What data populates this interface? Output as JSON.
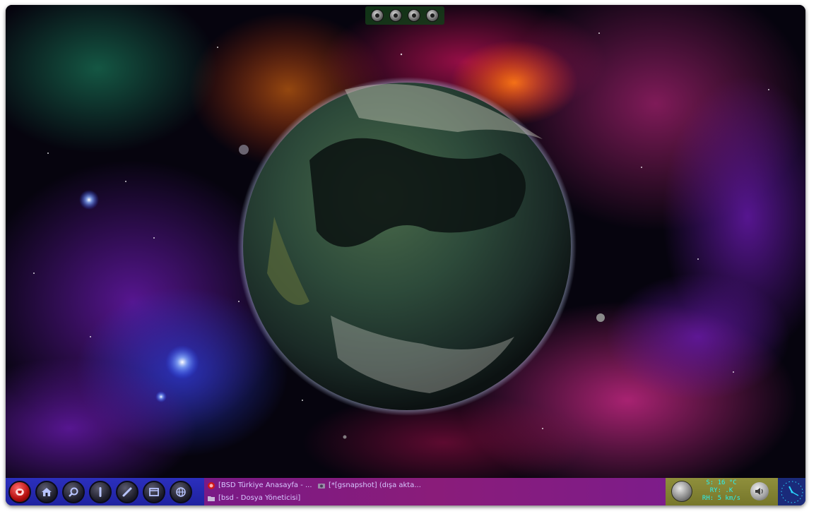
{
  "top_toolbar": {
    "buttons": [
      "window-icon",
      "circle-icon",
      "settings-icon",
      "brush-icon"
    ]
  },
  "panel": {
    "launchers": [
      "menu-icon",
      "home-icon",
      "search-icon",
      "terminal-icon",
      "pen-icon",
      "window-icon",
      "globe-icon"
    ],
    "tasks": [
      {
        "label": "[BSD Türkiye Anasayfa - ...",
        "icon": "browser-icon"
      },
      {
        "label": "[*[gsnapshot] (dışa akta...",
        "icon": "snapshot-icon"
      },
      {
        "label": "[bsd - Dosya Yöneticisi]",
        "icon": "folder-icon"
      }
    ],
    "weather": {
      "line1": "S: 16 °C",
      "line2": "RY: .K",
      "line3": "RH: 5 km/s"
    },
    "tray_icons": [
      "weather-icon",
      "volume-icon",
      "clock-icon"
    ]
  },
  "colors": {
    "panel": "#2c2cb4",
    "tasks": "#7d1c8a",
    "tray": "#7f7f30",
    "weather_text": "#2af0f0",
    "task_text": "#d7c7ff"
  }
}
